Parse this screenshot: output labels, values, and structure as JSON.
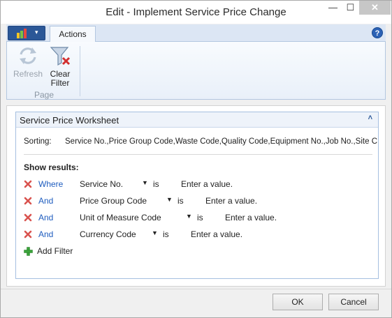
{
  "window": {
    "title": "Edit - Implement Service Price Change",
    "minimize_glyph": "—",
    "maximize_glyph": "☐",
    "close_glyph": "✕"
  },
  "ribbon": {
    "app_button_caret": "▾",
    "tabs": [
      {
        "label": "Actions"
      }
    ],
    "help_glyph": "?",
    "buttons": {
      "refresh": {
        "line1": "Refresh",
        "line2": "",
        "enabled": false
      },
      "clear_filter": {
        "line1": "Clear",
        "line2": "Filter",
        "enabled": true
      }
    },
    "group_label": "Page"
  },
  "fasttab": {
    "title": "Service Price Worksheet",
    "collapse_glyph": "˄",
    "sorting_label": "Sorting:",
    "sorting_value": "Service No.,Price Group Code,Waste Code,Quality Code,Equipment No.,Job No.,Site C",
    "show_results_label": "Show results:",
    "filters": [
      {
        "conjunction": "Where",
        "field": "Service No.",
        "dropdown": "▼",
        "operator": "is",
        "value": "Enter a value."
      },
      {
        "conjunction": "And",
        "field": "Price Group Code",
        "dropdown": "▼",
        "operator": "is",
        "value": "Enter a value."
      },
      {
        "conjunction": "And",
        "field": "Unit of Measure Code",
        "dropdown": "▼",
        "operator": "is",
        "value": "Enter a value."
      },
      {
        "conjunction": "And",
        "field": "Currency Code",
        "dropdown": "▼",
        "operator": "is",
        "value": "Enter a value."
      }
    ],
    "add_filter_label": "Add Filter"
  },
  "footer": {
    "ok_label": "OK",
    "cancel_label": "Cancel"
  },
  "colors": {
    "accent": "#2b5797",
    "link": "#1f5dbf",
    "delete_red": "#d9534f",
    "add_green": "#3aa33a"
  }
}
